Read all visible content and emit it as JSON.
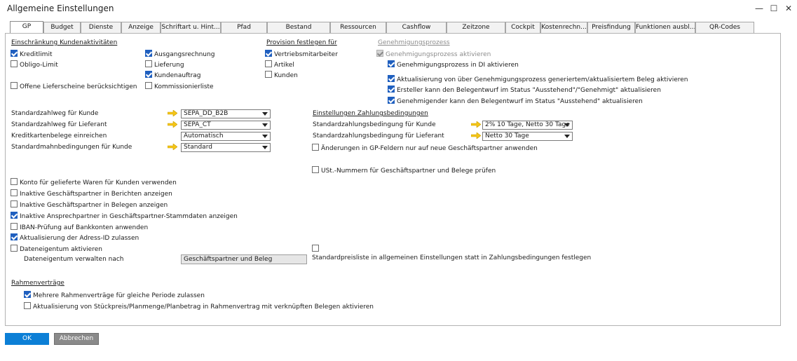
{
  "window": {
    "title": "Allgemeine Einstellungen",
    "minimize": "—",
    "maximize": "☐",
    "close": "✕"
  },
  "tabs": [
    "GP",
    "Budget",
    "Dienste",
    "Anzeige",
    "Schriftart u. Hint...",
    "Pfad",
    "Bestand",
    "Ressourcen",
    "Cashflow",
    "Zeitzone",
    "Cockpit",
    "Kostenrechn...",
    "Preisfindung",
    "Funktionen ausbl...",
    "QR-Codes"
  ],
  "active_tab": "GP",
  "restriction": {
    "heading": "Einschränkung Kundenaktivitäten",
    "credit_limit": {
      "label": "Kreditlimit",
      "checked": true
    },
    "obligo_limit": {
      "label": "Obligo-Limit",
      "checked": false
    },
    "open_deliveries": {
      "label": "Offene Lieferscheine berücksichtigen",
      "checked": false
    },
    "outgoing_invoice": {
      "label": "Ausgangsrechnung",
      "checked": true
    },
    "delivery": {
      "label": "Lieferung",
      "checked": false
    },
    "sales_order": {
      "label": "Kundenauftrag",
      "checked": true
    },
    "pick_list": {
      "label": "Kommissionierliste",
      "checked": false
    }
  },
  "commission": {
    "heading": "Provision festlegen für",
    "sales_employees": {
      "label": "Vertriebsmitarbeiter",
      "checked": true
    },
    "items": {
      "label": "Artikel",
      "checked": false
    },
    "customers": {
      "label": "Kunden",
      "checked": false
    }
  },
  "approval": {
    "heading": "Genehmigungsprozess",
    "activate": {
      "label": "Genehmigungsprozess aktivieren",
      "checked": true
    },
    "in_di": {
      "label": "Genehmigungsprozess in DI aktivieren",
      "checked": true
    },
    "update_generated": {
      "label": "Aktualisierung von über Genehmigungsprozess generiertem/aktualisiertem Beleg aktivieren",
      "checked": true
    },
    "creator_update": {
      "label": "Ersteller kann den Belegentwurf im Status \"Ausstehend\"/\"Genehmigt\" aktualisieren",
      "checked": true
    },
    "approver_update": {
      "label": "Genehmigender kann den Belegentwurf im Status \"Ausstehend\" aktualisieren",
      "checked": true
    }
  },
  "defaults": {
    "customer_payment_label": "Standardzahlweg für Kunde",
    "customer_payment_value": "SEPA_DD_B2B",
    "vendor_payment_label": "Standardzahlweg für Lieferant",
    "vendor_payment_value": "SEPA_CT",
    "credit_card_label": "Kreditkartenbelege einreichen",
    "credit_card_value": "Automatisch",
    "dunning_label": "Standardmahnbedingungen für Kunde",
    "dunning_value": "Standard"
  },
  "payment_terms": {
    "heading": "Einstellungen Zahlungsbedingungen",
    "customer_label": "Standardzahlungsbedingung für Kunde",
    "customer_value": "2% 10 Tage, Netto 30 Tage",
    "vendor_label": "Standardzahlungsbedingung für Lieferant",
    "vendor_value": "Netto 30 Tage",
    "changes_new_only": {
      "label": "Änderungen in GP-Feldern nur auf neue Geschäftspartner anwenden",
      "checked": false
    },
    "vat_check": {
      "label": "USt.-Nummern für Geschäftspartner und Belege prüfen",
      "checked": false
    }
  },
  "options": [
    {
      "label": "Konto für gelieferte Waren für Kunden verwenden",
      "checked": false
    },
    {
      "label": "Inaktive Geschäftspartner in Berichten anzeigen",
      "checked": false
    },
    {
      "label": "Inaktive Geschäftspartner in Belegen anzeigen",
      "checked": false
    },
    {
      "label": "Inaktive Ansprechpartner in Geschäftspartner-Stammdaten anzeigen",
      "checked": true
    },
    {
      "label": "IBAN-Prüfung auf Bankkonten anwenden",
      "checked": false
    },
    {
      "label": "Aktualisierung der Adress-ID zulassen",
      "checked": true
    },
    {
      "label": "Dateneigentum aktivieren",
      "checked": false
    }
  ],
  "data_ownership": {
    "label": "Dateneigentum verwalten nach",
    "value": "Geschäftspartner und Beleg"
  },
  "price_list": {
    "label": "Standardpreisliste in allgemeinen Einstellungen statt in Zahlungsbedingungen festlegen",
    "checked": false
  },
  "framework": {
    "heading": "Rahmenverträge",
    "multiple": {
      "label": "Mehrere Rahmenverträge für gleiche Periode zulassen",
      "checked": true
    },
    "update_prices": {
      "label": "Aktualisierung von Stückpreis/Planmenge/Planbetrag in Rahmenvertrag mit verknüpften Belegen aktivieren",
      "checked": false
    }
  },
  "buttons": {
    "ok": "OK",
    "cancel": "Abbrechen"
  },
  "colors": {
    "accent": "#1f5fbf",
    "ok_button": "#0c7fd6",
    "arrow": "#f5c518"
  }
}
